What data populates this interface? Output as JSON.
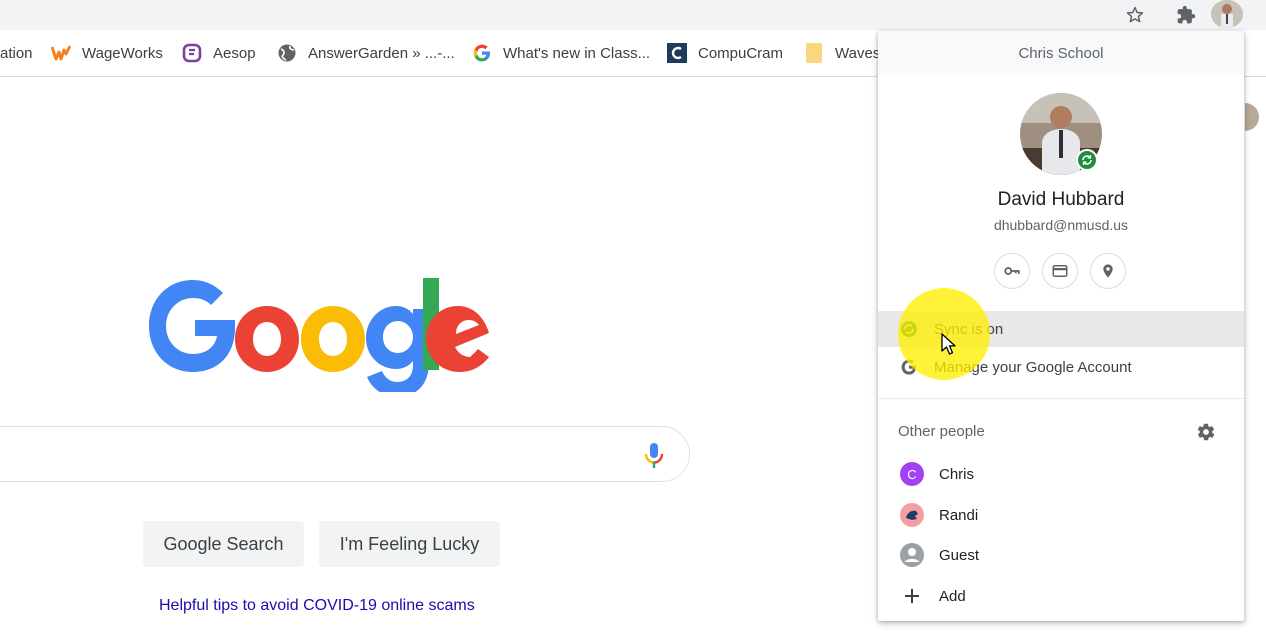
{
  "toolbar": {
    "icons": [
      "star-icon",
      "extensions-puzzle-icon",
      "profile-avatar"
    ],
    "colors": {
      "background": "#f1f3f4"
    }
  },
  "bookmarks": [
    {
      "label": "ation",
      "icon": "bookmark-partial"
    },
    {
      "label": "WageWorks",
      "icon": "wageworks-icon",
      "color": "#f5821f"
    },
    {
      "label": "Aesop",
      "icon": "aesop-icon",
      "color": "#7b3fa0"
    },
    {
      "label": "AnswerGarden » ...-...",
      "icon": "globe-icon"
    },
    {
      "label": "What's new in Class...",
      "icon": "google-g-icon"
    },
    {
      "label": "CompuCram",
      "icon": "compucram-icon",
      "color": "#1f3a5a"
    },
    {
      "label": "Waves",
      "icon": "folder-icon",
      "color": "#f9d77e"
    }
  ],
  "google": {
    "logo_text": "Google",
    "search_button": "Google Search",
    "lucky_button": "I'm Feeling Lucky",
    "tips_link": "Helpful tips to avoid COVID-19 online scams",
    "colors": {
      "blue": "#4285f4",
      "red": "#ea4335",
      "yellow": "#fbbc05",
      "green": "#34a853",
      "link": "#1a0dab"
    }
  },
  "profile_popup": {
    "header": "Chris School",
    "name": "David Hubbard",
    "email": "dhubbard@nmusd.us",
    "quick_icons": [
      "key-icon",
      "credit-card-icon",
      "location-pin-icon"
    ],
    "menu": [
      {
        "label": "Sync is on",
        "icon": "sync-icon"
      },
      {
        "label": "Manage your Google Account",
        "icon": "google-g-icon"
      }
    ],
    "other_people_title": "Other people",
    "people": [
      {
        "label": "Chris",
        "initial": "C",
        "color": "#a142f4"
      },
      {
        "label": "Randi",
        "icon": "avatar-icon",
        "color": "#f4a0a0"
      },
      {
        "label": "Guest",
        "icon": "guest-icon",
        "color": "#9aa0a6"
      },
      {
        "label": "Add",
        "icon": "plus-icon"
      }
    ],
    "colors": {
      "sync_green": "#1e8e3e",
      "highlight_yellow": "#ffee00"
    }
  }
}
